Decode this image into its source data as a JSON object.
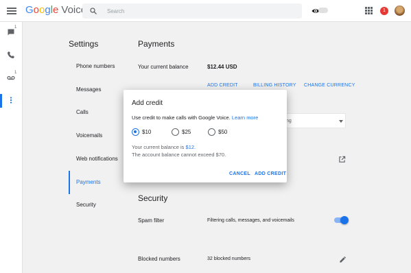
{
  "app": {
    "logo_google": "Google",
    "logo_voice": "Voice"
  },
  "search": {
    "placeholder": "Search"
  },
  "topbar": {
    "notifications_count": "1"
  },
  "rail": [
    {
      "icon": "message-icon",
      "count": "1"
    },
    {
      "icon": "phone-icon",
      "count": ""
    },
    {
      "icon": "voicemail-icon",
      "count": "1"
    },
    {
      "icon": "more-vert-icon",
      "count": ""
    }
  ],
  "settings": {
    "title": "Settings",
    "nav": [
      {
        "label": "Phone numbers"
      },
      {
        "label": "Messages"
      },
      {
        "label": "Calls"
      },
      {
        "label": "Voicemails"
      },
      {
        "label": "Web notifications"
      },
      {
        "label": "Payments",
        "active": true
      },
      {
        "label": "Security"
      }
    ]
  },
  "payments": {
    "title": "Payments",
    "balance_label": "Your current balance",
    "balance_value": "$12.44 USD",
    "add_credit": "ADD CREDIT",
    "billing_history": "BILLING HISTORY",
    "change_currency": "CHANGE CURRENCY",
    "currency_dropdown_visible_text": "ng"
  },
  "security": {
    "title": "Security",
    "spam_label": "Spam filter",
    "spam_desc": "Filtering calls, messages, and voicemails",
    "spam_enabled": true,
    "blocked_label": "Blocked numbers",
    "blocked_desc": "32 blocked numbers"
  },
  "dialog": {
    "title": "Add credit",
    "desc": "Use credit to make calls with Google Voice.",
    "learn_more": "Learn more",
    "options": [
      "$10",
      "$25",
      "$50"
    ],
    "selected": "$10",
    "balance_note_prefix": "Your current balance is",
    "balance_note_amount": "$12.",
    "limit_note": "The account balance cannot exceed $70.",
    "cancel": "CANCEL",
    "confirm": "ADD CREDIT"
  },
  "colors": {
    "accent": "#1a73e8",
    "badge": "#e53935",
    "background": "#f1f1f1"
  }
}
